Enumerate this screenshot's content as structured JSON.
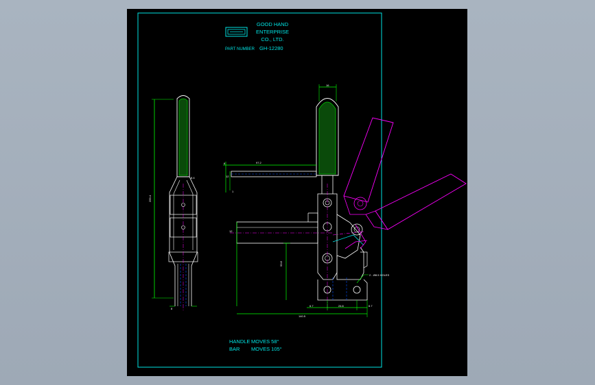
{
  "title_block": {
    "company_line1": "GOOD HAND",
    "company_line2": "ENTERPRISE",
    "company_line3": "CO., LTD.",
    "part_number_label": "PART NUMBER",
    "part_number": "GH-12280"
  },
  "notes": {
    "handle_label": "HANDLE",
    "handle_moves": "MOVES 58°",
    "bar_label": "BAR",
    "bar_moves": "MOVES 105°"
  },
  "dimensions": {
    "side_height": "259.4",
    "side_top": "8.4",
    "side_bottom": "8",
    "top_width": "16",
    "bar_length": "97.2",
    "bar_end": "6",
    "bar_height": "12",
    "bar_tip": "1",
    "depth": "12",
    "vertical": "53.8",
    "base_left": "6.7",
    "base_mid": "24.6",
    "base_right": "6.7",
    "overall": "140.5",
    "holes": "2 - Ø8.5 HOLES"
  },
  "colors": {
    "frame": "#00e5e5",
    "outline": "#ffffff",
    "dimension": "#00ff00",
    "grip": "#00c400",
    "alternate": "#ff00ff",
    "background": "#000000",
    "hidden": "#0050ff"
  }
}
